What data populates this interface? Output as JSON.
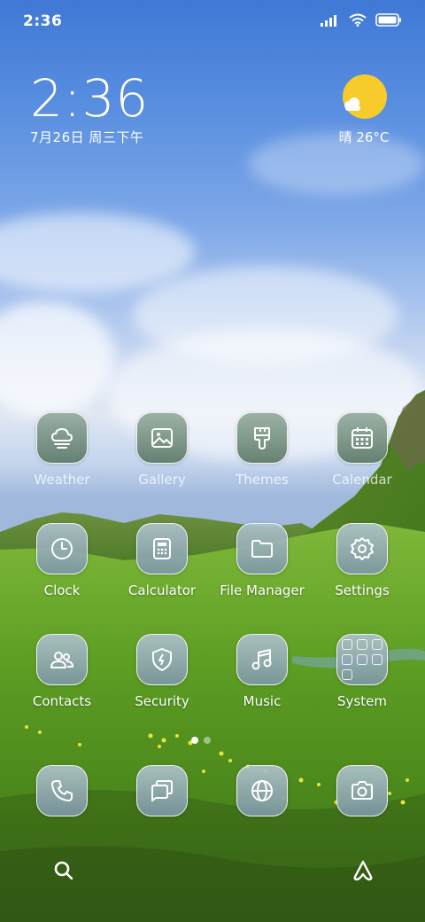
{
  "status_bar": {
    "time": "2:36"
  },
  "clock_widget": {
    "time": "2:36",
    "date": "7月26日 周三下午"
  },
  "weather_widget": {
    "condition_temp": "晴 26°C",
    "icon": "sun-cloud-icon"
  },
  "apps": [
    {
      "label": "Weather",
      "icon": "weather-cloud-icon"
    },
    {
      "label": "Gallery",
      "icon": "gallery-icon"
    },
    {
      "label": "Themes",
      "icon": "themes-brush-icon"
    },
    {
      "label": "Calendar",
      "icon": "calendar-icon"
    },
    {
      "label": "Clock",
      "icon": "clock-icon"
    },
    {
      "label": "Calculator",
      "icon": "calculator-icon"
    },
    {
      "label": "File Manager",
      "icon": "folder-icon"
    },
    {
      "label": "Settings",
      "icon": "gear-icon"
    },
    {
      "label": "Contacts",
      "icon": "contacts-icon"
    },
    {
      "label": "Security",
      "icon": "shield-icon"
    },
    {
      "label": "Music",
      "icon": "music-note-icon"
    },
    {
      "label": "System",
      "icon": "folder-grid-icon"
    }
  ],
  "dock": [
    {
      "name": "phone",
      "icon": "phone-icon"
    },
    {
      "name": "messages",
      "icon": "message-icon"
    },
    {
      "name": "browser",
      "icon": "globe-icon"
    },
    {
      "name": "camera",
      "icon": "camera-icon"
    }
  ],
  "page_indicator": {
    "pages": 2,
    "current": 1
  },
  "bottom_bar": {
    "search_icon": "search-icon",
    "assistant_icon": "assistant-icon"
  },
  "colors": {
    "sun": "#f7cb2c",
    "dot_active": "#ffffff",
    "dot_inactive": "rgba(255,255,255,0.45)"
  }
}
